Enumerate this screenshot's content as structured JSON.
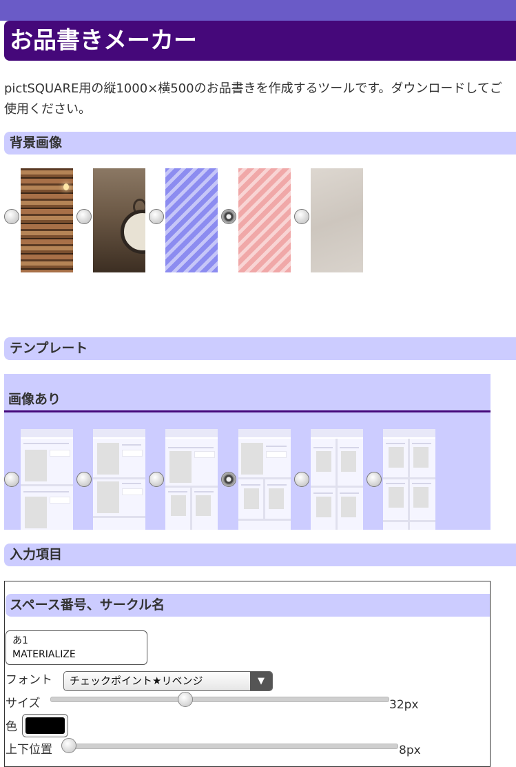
{
  "app": {
    "title": "お品書きメーカー"
  },
  "intro": {
    "text": "pictSQUARE用の縦1000×横500のお品書きを作成するツールです。ダウンロードしてご使用ください。"
  },
  "background_section": {
    "heading": "背景画像",
    "options": [
      {
        "name": "bookshelf",
        "selected": false
      },
      {
        "name": "pocket-watch",
        "selected": false
      },
      {
        "name": "blue-stripes",
        "selected": false
      },
      {
        "name": "pink-stripes",
        "selected": true
      },
      {
        "name": "beige-paper",
        "selected": false
      }
    ]
  },
  "template_section": {
    "heading": "テンプレート",
    "subheading": "画像あり",
    "selected_index": 3
  },
  "input_section": {
    "heading": "入力項目",
    "group_heading": "スペース番号、サークル名",
    "text_value": "あ1\nMATERIALIZE",
    "font_label": "フォント",
    "font_value": "チェックポイント★リベンジ",
    "font_arrow": "▼",
    "size_label": "サイズ",
    "size_value": "32px",
    "size_level": 0.4,
    "color_label": "色",
    "color_value": "#000000",
    "vpos_label": "上下位置",
    "vpos_value": "8px",
    "vpos_level": 0.0
  },
  "colors": {
    "accent": "#45087a",
    "bar_top": "#6a5bc7",
    "section_bg": "#ccccff"
  }
}
